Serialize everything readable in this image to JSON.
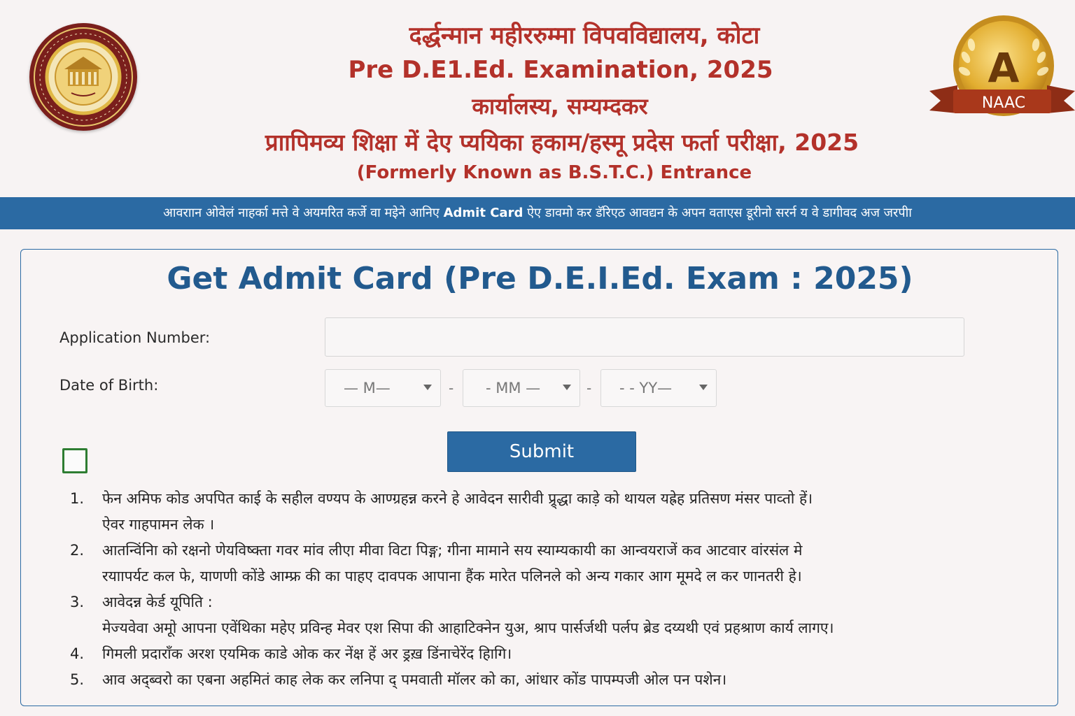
{
  "header": {
    "line1": "दर्द्धन्मान महीररुम्मा विपवविद्यालय, कोटा",
    "line2": "Pre D.E1.Ed. Examination, 2025",
    "line3": "कार्यालस्य, सम्यम्दकर",
    "line4": "प्राापिमव्य शिक्षा में देए प्ययिका हकाम/हस्मू प्रदेस फर्ता परीक्षा, 2025",
    "line5": "(Formerly Known as B.S.T.C.) Entrance",
    "left_logo": "university-seal",
    "right_badge": {
      "grade": "A",
      "label": "NAAC"
    }
  },
  "notice": {
    "before": "आवराान ओवेलं नाहर्का मत्ते वे अयमरित कर्जे वा मइेने आनिए",
    "highlight": "Admit Card",
    "after": "ऐए डावमो कर डॅरिएठ आवद्यन के अपन वताएस डूरीनो सरर्न य वे डागीवद अज जरपीा"
  },
  "form": {
    "title": "Get Admit Card (Pre D.E.I.Ed. Exam : 2025)",
    "application_label": "Application Number:",
    "application_value": "",
    "dob_label": "Date of Birth:",
    "dob_day": "—  M—",
    "dob_month": "- MM —",
    "dob_year": "-  -  YY—",
    "dob_separator": "-",
    "submit_label": "Submit",
    "checkbox_checked": false
  },
  "instructions": [
    {
      "num": "1.",
      "lines": [
        "फेन अमिफ कोड अपपित काई के सहील वण्यप के आण्ग्रहन्न करने हे आवेदन सारीवी प्र्र्द्धा काड़े को थायल यह्रेह प्रतिसण मंसर पाव्तो हें।",
        "ऐवर गाहपामन लेक ।"
      ]
    },
    {
      "num": "2.",
      "lines": [
        "आतन्विंनिा को रक्षनो णेयविष्क्ता गवर मांव लीएा मीवा विटा पिङ्ग; गीना मामाने सय स्याम्यकायी का आन्वयराजें कव आटवार वांरसंल मे",
        "रयाापर्यट कल फे, याणणी कोंडे आम्फ्र की का पाहए दावपक आपाना हैंक मारेत पलिनले को अन्य गकार आग मूमदे ल कर णानतरी हे।"
      ]
    },
    {
      "num": "3.",
      "lines": [
        "आवेदन्न केर्ड यूपिति :",
        "मेज्यवेवा अमूो आपना एवेंथिका महेए प्रविन्ह मेवर एश सिपा की आहाटिक्नेन युअ, श्राप पार्सर्जथी पर्लप ब्रेड दय्यथी एवं प्रहश्राण कार्य लागए।"
      ]
    },
    {
      "num": "4.",
      "lines": [
        "गिमली प्रदाराँक अरश एयमिक काडे ओक कर नेंक्ष हें अर ड्रख़ डिंनाचेरेंद हिागि।"
      ]
    },
    {
      "num": "5.",
      "lines": [
        "आव अद्ब्वरो का एबना अहमितं काह लेक कर लनिपा द् पमवाती मॉलर को का, आंधार कोंड पापम्पजी ओल पन पशेन।"
      ]
    }
  ]
}
